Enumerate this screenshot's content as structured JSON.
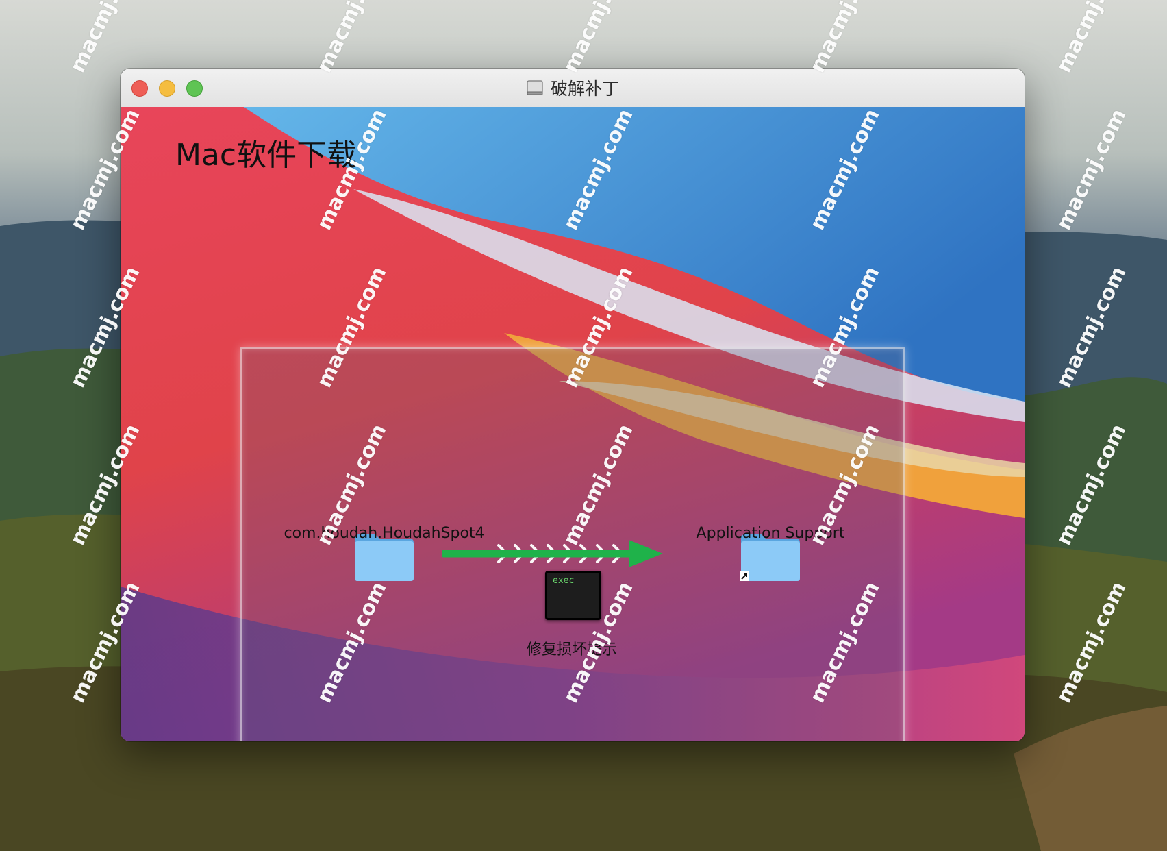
{
  "window": {
    "title": "破解补丁",
    "title_icon": "disk-icon"
  },
  "content": {
    "brand_text": "Mac软件下载",
    "items": [
      {
        "label": "com.houdah.HoudahSpot4",
        "icon": "folder-icon"
      },
      {
        "label": "Application Support",
        "icon": "folder-alias-icon"
      },
      {
        "label": "修复损坏提示",
        "icon": "terminal-exec-icon",
        "icon_text": "exec"
      }
    ],
    "arrow": {
      "icon": "arrow-right-icon",
      "color": "#1fb24a"
    }
  },
  "watermark": {
    "text": "macmj.com"
  },
  "colors": {
    "traffic_close": "#ee5e56",
    "traffic_minimize": "#f5bd3f",
    "traffic_zoom": "#5fc454",
    "folder_blue": "#8ccaf7"
  }
}
